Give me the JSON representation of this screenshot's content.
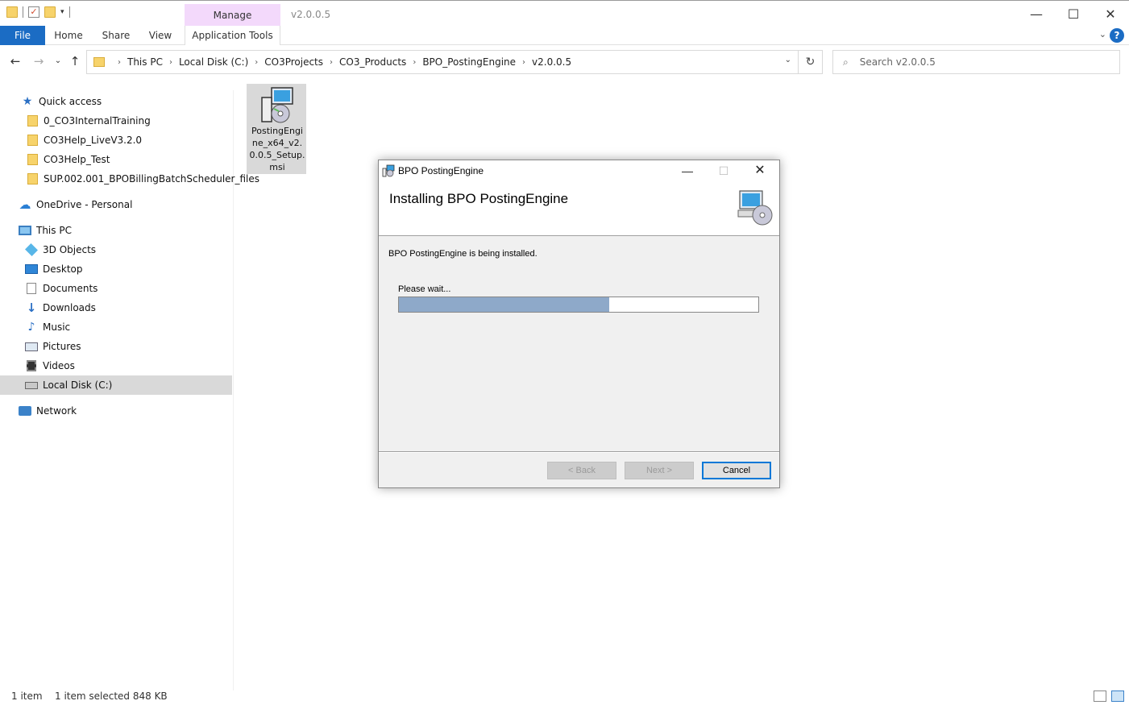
{
  "window": {
    "title": "v2.0.0.5",
    "manage_tab": "Manage",
    "minimize": "—",
    "maximize": "☐",
    "close": "✕"
  },
  "ribbon": {
    "tabs": {
      "file": "File",
      "home": "Home",
      "share": "Share",
      "view": "View",
      "app_tools": "Application Tools"
    },
    "collapse_glyph": "⌄",
    "help_glyph": "?"
  },
  "nav": {
    "back_glyph": "←",
    "forward_glyph": "→",
    "recent_glyph": "⌄",
    "up_glyph": "↑"
  },
  "address": {
    "crumbs": [
      "This PC",
      "Local Disk (C:)",
      "CO3Projects",
      "CO3_Products",
      "BPO_PostingEngine",
      "v2.0.0.5"
    ],
    "dropdown_glyph": "⌄",
    "refresh_glyph": "↻"
  },
  "search": {
    "placeholder": "Search v2.0.0.5",
    "icon_glyph": "⌕"
  },
  "sidebar": {
    "quick_access": "Quick access",
    "qa_items": [
      "0_CO3InternalTraining",
      "CO3Help_LiveV3.2.0",
      "CO3Help_Test",
      "SUP.002.001_BPOBillingBatchScheduler_files"
    ],
    "onedrive": "OneDrive - Personal",
    "this_pc": "This PC",
    "pc_items": [
      "3D Objects",
      "Desktop",
      "Documents",
      "Downloads",
      "Music",
      "Pictures",
      "Videos",
      "Local Disk (C:)"
    ],
    "network": "Network",
    "selected": "Local Disk (C:)"
  },
  "content": {
    "file_name": "PostingEngine_x64_v2.0.0.5_Setup.msi"
  },
  "status": {
    "count": "1 item",
    "selection": "1 item selected  848 KB"
  },
  "installer": {
    "title": "BPO PostingEngine",
    "heading": "Installing BPO PostingEngine",
    "message": "BPO PostingEngine is being installed.",
    "wait_text": "Please wait...",
    "progress_fraction": 0.585,
    "buttons": {
      "back": "< Back",
      "next": "Next >",
      "cancel": "Cancel"
    },
    "min_glyph": "—",
    "max_glyph": "☐",
    "close_glyph": "✕"
  },
  "colors": {
    "file_tab": "#1b6cc4",
    "manage_tab": "#f3d9fb",
    "progress_fill": "#8ea9c9",
    "selection": "#d9d9d9"
  }
}
